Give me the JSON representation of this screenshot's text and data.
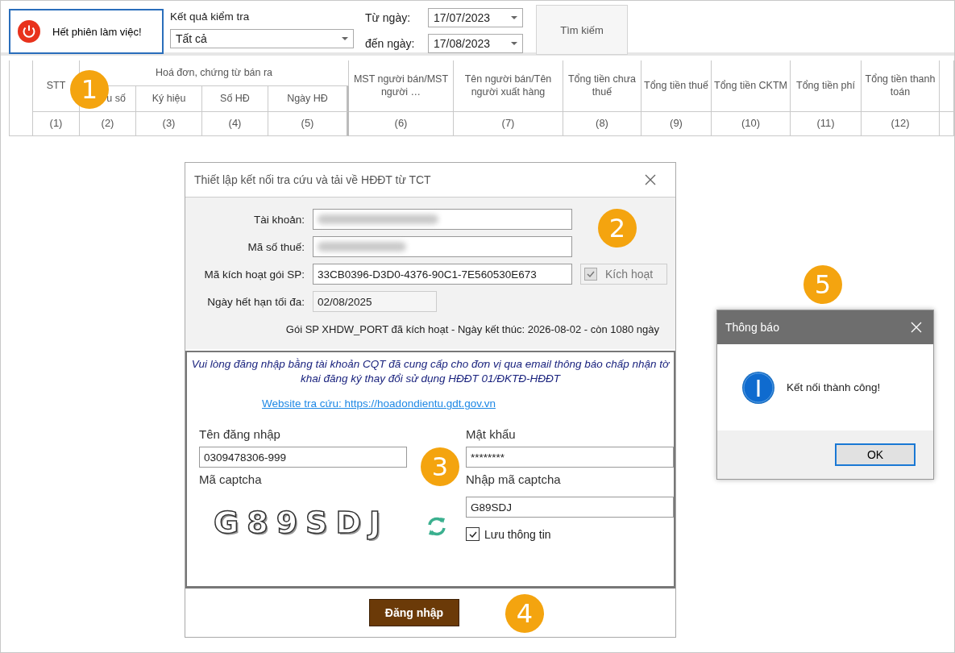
{
  "toolbar": {
    "logout_button": "Hết phiên làm việc!",
    "result_label": "Kết quả kiểm tra",
    "result_value": "Tất cả",
    "from_label": "Từ ngày:",
    "from_value": "17/07/2023",
    "to_label": "đến ngày:",
    "to_value": "17/08/2023",
    "search_button": "Tìm kiếm"
  },
  "table": {
    "group_title": "Hoá đơn, chứng từ bán ra",
    "columns": [
      {
        "label": "STT",
        "number": "(1)",
        "in_group": false
      },
      {
        "label": "u số",
        "number": "(2)",
        "in_group": true
      },
      {
        "label": "Ký hiệu",
        "number": "(3)",
        "in_group": true
      },
      {
        "label": "Số HĐ",
        "number": "(4)",
        "in_group": true
      },
      {
        "label": "Ngày HĐ",
        "number": "(5)",
        "in_group": true
      },
      {
        "label": "MST người bán/MST người …",
        "number": "(6)",
        "in_group": false
      },
      {
        "label": "Tên người bán/Tên người xuất hàng",
        "number": "(7)",
        "in_group": false
      },
      {
        "label": "Tổng tiền chưa thuế",
        "number": "(8)",
        "in_group": false
      },
      {
        "label": "Tổng tiền thuế",
        "number": "(9)",
        "in_group": false
      },
      {
        "label": "Tổng tiền CKTM",
        "number": "(10)",
        "in_group": false
      },
      {
        "label": "Tổng tiền phí",
        "number": "(11)",
        "in_group": false
      },
      {
        "label": "Tổng tiền thanh toán",
        "number": "(12)",
        "in_group": false
      }
    ]
  },
  "dialog": {
    "title": "Thiết lập kết nối tra cứu và tải về HĐĐT từ TCT",
    "account_label": "Tài khoản:",
    "tax_label": "Mã số thuế:",
    "code_label": "Mã kích hoạt gói SP:",
    "code_value": "33CB0396-D3D0-4376-90C1-7E560530E673",
    "activate_button": "Kích hoạt",
    "activated": true,
    "expiry_label": "Ngày hết hạn tối đa:",
    "expiry_value": "02/08/2025",
    "package_status": "Gói SP XHDW_PORT đã kích hoạt - Ngày kết thúc: 2026-08-02 - còn 1080 ngày",
    "notice": "Vui lòng đăng nhập bằng tài khoản CQT đã cung cấp cho đơn vị qua email thông báo chấp nhận tờ khai đăng ký thay đổi sử dụng HĐĐT 01/ĐKTĐ-HĐĐT",
    "website_link": "Website tra cứu: https://hoadondientu.gdt.gov.vn",
    "username_label": "Tên đăng nhập",
    "username_value": "0309478306-999",
    "password_label": "Mật khẩu",
    "password_value": "********",
    "captcha_label": "Mã captcha",
    "captcha_text": "G89SDJ",
    "captcha_input_label": "Nhập mã captcha",
    "captcha_input_value": "G89SDJ",
    "remember_label": "Lưu thông tin",
    "remember_checked": true,
    "login_button": "Đăng nhập"
  },
  "message_box": {
    "title": "Thông báo",
    "message": "Kết nối thành công!",
    "ok_button": "OK"
  },
  "step_badges": [
    "1",
    "2",
    "3",
    "4",
    "5"
  ]
}
